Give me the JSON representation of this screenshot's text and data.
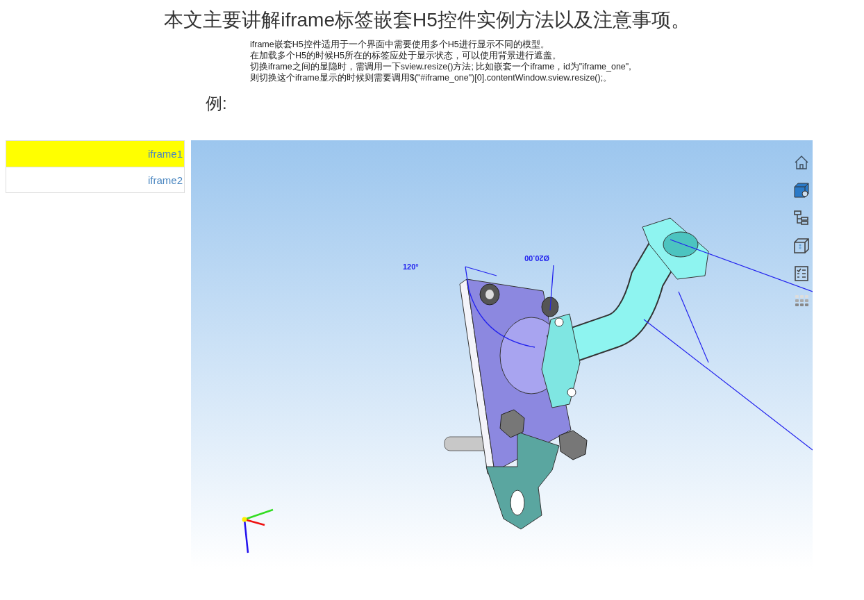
{
  "title": "本文主要讲解iframe标签嵌套H5控件实例方法以及注意事项。",
  "intro": [
    "iframe嵌套H5控件适用于一个界面中需要使用多个H5进行显示不同的模型。",
    "在加载多个H5的时候H5所在的标签应处于显示状态，可以使用背景进行遮盖。",
    "切换iframe之间的显隐时，需调用一下sview.resize()方法; 比如嵌套一个iframe，id为\"iframe_one\",",
    "则切换这个iframe显示的时候则需要调用$(\"#iframe_one\")[0].contentWindow.sview.resize();。"
  ],
  "example_label": "例:",
  "tabs": [
    {
      "label": "iframe1",
      "selected": true
    },
    {
      "label": "iframe2",
      "selected": false
    }
  ],
  "viewer": {
    "angle_label": "120°",
    "diameter_label": "Ø20.00"
  }
}
